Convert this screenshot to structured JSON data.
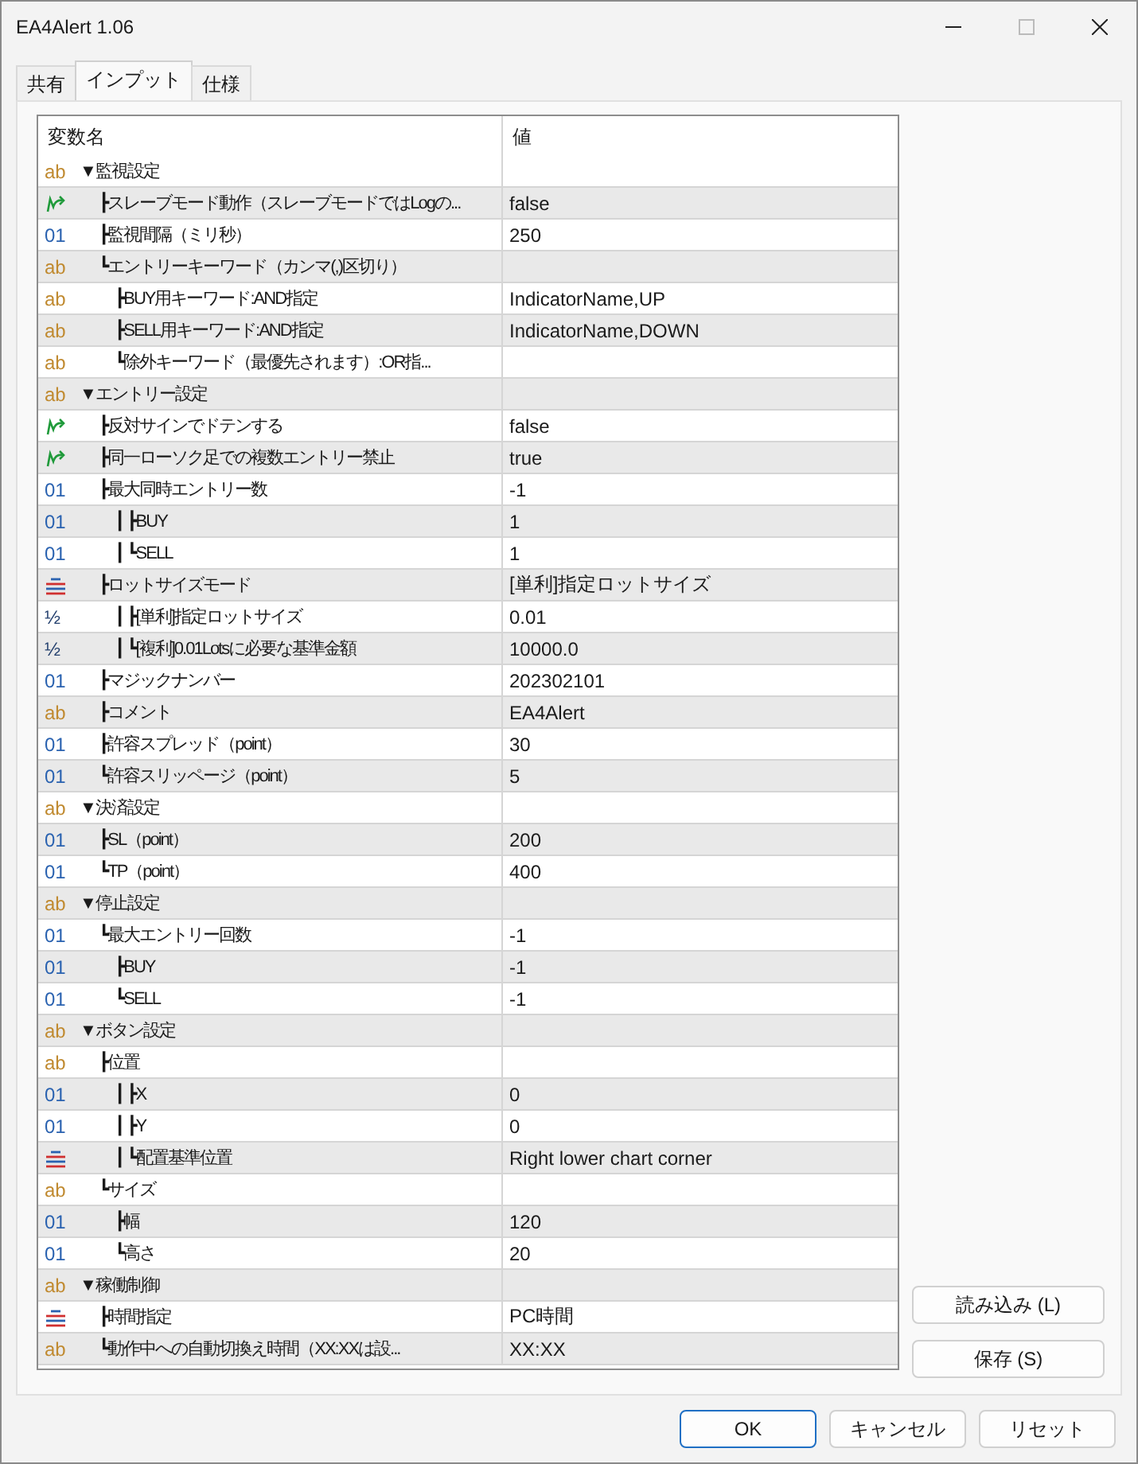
{
  "window": {
    "title": "EA4Alert 1.06"
  },
  "tabs": [
    {
      "label": "共有",
      "selected": false
    },
    {
      "label": "インプット",
      "selected": true
    },
    {
      "label": "仕様",
      "selected": false
    }
  ],
  "table": {
    "columns": [
      "変数名",
      "値"
    ],
    "groups": [
      {
        "kind": "string",
        "type_label": "ab",
        "name": "▼監視設定",
        "children": [
          {
            "kind": "bool",
            "name": "┣スレーブモード動作（スレーブモードではLogの...",
            "value": "false"
          },
          {
            "kind": "int",
            "type_label": "01",
            "name": "┣監視間隔（ミリ秒）",
            "value": "250"
          },
          {
            "kind": "string",
            "type_label": "ab",
            "name": "┗エントリーキーワード（カンマ(,)区切り）",
            "children": [
              {
                "kind": "string",
                "type_label": "ab",
                "name": "┣BUY用キーワード:AND指定",
                "value": "IndicatorName,UP"
              },
              {
                "kind": "string",
                "type_label": "ab",
                "name": "┣SELL用キーワード:AND指定",
                "value": "IndicatorName,DOWN"
              },
              {
                "kind": "string",
                "type_label": "ab",
                "name": "┗除外キーワード（最優先されます）:OR指..."
              }
            ]
          }
        ]
      },
      {
        "kind": "string",
        "type_label": "ab",
        "name": "▼エントリー設定",
        "children": [
          {
            "kind": "bool",
            "name": "┣反対サインでドテンする",
            "value": "false"
          },
          {
            "kind": "bool",
            "name": "┣同一ローソク足での複数エントリー禁止",
            "value": "true"
          },
          {
            "kind": "int",
            "type_label": "01",
            "name": "┣最大同時エントリー数",
            "value": "-1",
            "children": [
              {
                "kind": "int",
                "type_label": "01",
                "name": "┃ ┣BUY",
                "value": "1"
              },
              {
                "kind": "int",
                "type_label": "01",
                "name": "┃ ┗SELL",
                "value": "1"
              }
            ]
          },
          {
            "kind": "enum",
            "name": "┣ロットサイズモード",
            "value": "[単利]指定ロットサイズ",
            "children": [
              {
                "kind": "double",
                "type_label": "½",
                "name": "┃ ┣[単利]指定ロットサイズ",
                "value": "0.01"
              },
              {
                "kind": "double",
                "type_label": "½",
                "name": "┃ ┗[複利]0.01Lotsに必要な基準金額",
                "value": "10000.0"
              }
            ]
          },
          {
            "kind": "int",
            "type_label": "01",
            "name": "┣マジックナンバー",
            "value": "202302101"
          },
          {
            "kind": "string",
            "type_label": "ab",
            "name": "┣コメント",
            "value": "EA4Alert"
          },
          {
            "kind": "int",
            "type_label": "01",
            "name": "┣許容スプレッド（point）",
            "value": "30"
          },
          {
            "kind": "int",
            "type_label": "01",
            "name": "┗許容スリッページ（point）",
            "value": "5"
          }
        ]
      },
      {
        "kind": "string",
        "type_label": "ab",
        "name": "▼決済設定",
        "children": [
          {
            "kind": "int",
            "type_label": "01",
            "name": "┣SL（point）",
            "value": "200"
          },
          {
            "kind": "int",
            "type_label": "01",
            "name": "┗TP（point）",
            "value": "400"
          }
        ]
      },
      {
        "kind": "string",
        "type_label": "ab",
        "name": "▼停止設定",
        "children": [
          {
            "kind": "int",
            "type_label": "01",
            "name": "┗最大エントリー回数",
            "value": "-1",
            "children": [
              {
                "kind": "int",
                "type_label": "01",
                "name": "┣BUY",
                "value": "-1"
              },
              {
                "kind": "int",
                "type_label": "01",
                "name": "┗SELL",
                "value": "-1"
              }
            ]
          }
        ]
      },
      {
        "kind": "string",
        "type_label": "ab",
        "name": "▼ボタン設定",
        "children": [
          {
            "kind": "string",
            "type_label": "ab",
            "name": "┣位置",
            "children": [
              {
                "kind": "int",
                "type_label": "01",
                "name": "┃ ┣X",
                "value": "0"
              },
              {
                "kind": "int",
                "type_label": "01",
                "name": "┃ ┣Y",
                "value": "0"
              },
              {
                "kind": "enum",
                "name": "┃ ┗配置基準位置",
                "value": "Right lower chart corner"
              }
            ]
          },
          {
            "kind": "string",
            "type_label": "ab",
            "name": "┗サイズ",
            "children": [
              {
                "kind": "int",
                "type_label": "01",
                "name": "┣幅",
                "value": "120"
              },
              {
                "kind": "int",
                "type_label": "01",
                "name": "┗高さ",
                "value": "20"
              }
            ]
          }
        ]
      },
      {
        "kind": "string",
        "type_label": "ab",
        "name": "▼稼働制御",
        "children": [
          {
            "kind": "enum",
            "name": "┣時間指定",
            "value": "PC時間"
          },
          {
            "kind": "string",
            "type_label": "ab",
            "name": "┗動作中への自動切換え時間（XX:XXは設...",
            "value": "XX:XX"
          }
        ]
      }
    ]
  },
  "side_buttons": [
    "読み込み (L)",
    "保存 (S)"
  ],
  "footer_buttons": [
    {
      "label": "OK",
      "kind": "default"
    },
    {
      "label": "キャンセル",
      "kind": "normal"
    },
    {
      "label": "リセット",
      "kind": "normal"
    }
  ]
}
